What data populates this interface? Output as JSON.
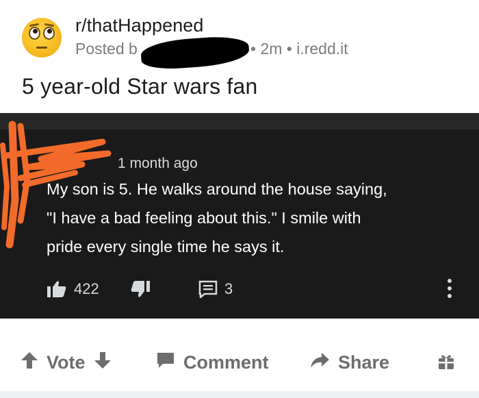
{
  "post": {
    "subreddit": "r/thatHappened",
    "posted_prefix": "Posted b",
    "meta_rest": "• 2m • i.redd.it",
    "title": "5 year-old Star wars fan"
  },
  "comment": {
    "time": "1 month ago",
    "lines": [
      "My son is 5.  He walks around the house saying,",
      "\"I have a bad feeling about this.\"  I smile with",
      "pride every single time he says it."
    ],
    "likes": "422",
    "replies": "3"
  },
  "actions": {
    "vote": "Vote",
    "comment": "Comment",
    "share": "Share"
  },
  "colors": {
    "dark_bg": "#1a1a1b",
    "scribble": "#f26b2a",
    "action_grey": "#6d6d6d"
  }
}
